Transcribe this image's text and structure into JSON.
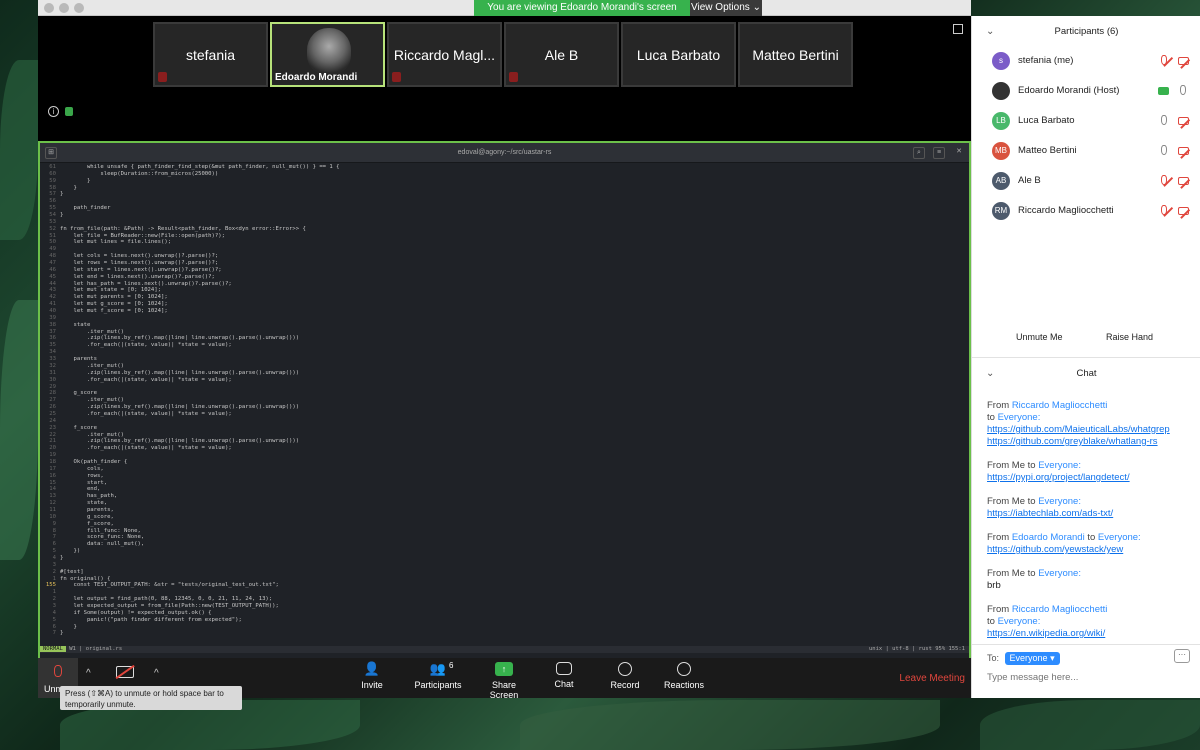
{
  "meeting": {
    "share_banner": "You are viewing Edoardo Morandi's screen",
    "view_options": "View Options"
  },
  "gallery": [
    {
      "name": "stefania",
      "muted": true
    },
    {
      "name": "Edoardo Morandi",
      "muted": false,
      "video": true
    },
    {
      "name": "Riccardo Magl...",
      "muted": true
    },
    {
      "name": "Ale B",
      "muted": true
    },
    {
      "name": "Luca Barbato",
      "muted": false
    },
    {
      "name": "Matteo Bertini",
      "muted": false
    }
  ],
  "terminal": {
    "title": "edoval@agony:~/src/uastar-rs",
    "status_mode": "NORMAL",
    "status_file": "W1 | original.rs",
    "status_right": "unix | utf-8 | rust   95%  155:1",
    "code_lines": [
      [
        "61",
        "        while unsafe { path_finder_find_step(&mut path_finder, null_mut()) } == 1 {"
      ],
      [
        "60",
        "            sleep(Duration::from_micros(25000))"
      ],
      [
        "59",
        "        }"
      ],
      [
        "58",
        "    }"
      ],
      [
        "57",
        "}"
      ],
      [
        "56",
        ""
      ],
      [
        "55",
        "    path_finder"
      ],
      [
        "54",
        "}"
      ],
      [
        "53",
        ""
      ],
      [
        "52",
        "fn from_file(path: &Path) -> Result<path_finder, Box<dyn error::Error>> {"
      ],
      [
        "51",
        "    let file = BufReader::new(File::open(path)?);"
      ],
      [
        "50",
        "    let mut lines = file.lines();"
      ],
      [
        "49",
        ""
      ],
      [
        "48",
        "    let cols = lines.next().unwrap()?.parse()?;"
      ],
      [
        "47",
        "    let rows = lines.next().unwrap()?.parse()?;"
      ],
      [
        "46",
        "    let start = lines.next().unwrap()?.parse()?;"
      ],
      [
        "45",
        "    let end = lines.next().unwrap()?.parse()?;"
      ],
      [
        "44",
        "    let has_path = lines.next().unwrap()?.parse()?;"
      ],
      [
        "43",
        "    let mut state = [0; 1024];"
      ],
      [
        "42",
        "    let mut parents = [0; 1024];"
      ],
      [
        "41",
        "    let mut g_score = [0; 1024];"
      ],
      [
        "40",
        "    let mut f_score = [0; 1024];"
      ],
      [
        "39",
        ""
      ],
      [
        "38",
        "    state"
      ],
      [
        "37",
        "        .iter_mut()"
      ],
      [
        "36",
        "        .zip(lines.by_ref().map(|line| line.unwrap().parse().unwrap()))"
      ],
      [
        "35",
        "        .for_each(|(state, value)| *state = value);"
      ],
      [
        "34",
        ""
      ],
      [
        "33",
        "    parents"
      ],
      [
        "32",
        "        .iter_mut()"
      ],
      [
        "31",
        "        .zip(lines.by_ref().map(|line| line.unwrap().parse().unwrap()))"
      ],
      [
        "30",
        "        .for_each(|(state, value)| *state = value);"
      ],
      [
        "29",
        ""
      ],
      [
        "28",
        "    g_score"
      ],
      [
        "27",
        "        .iter_mut()"
      ],
      [
        "26",
        "        .zip(lines.by_ref().map(|line| line.unwrap().parse().unwrap()))"
      ],
      [
        "25",
        "        .for_each(|(state, value)| *state = value);"
      ],
      [
        "24",
        ""
      ],
      [
        "23",
        "    f_score"
      ],
      [
        "22",
        "        .iter_mut()"
      ],
      [
        "21",
        "        .zip(lines.by_ref().map(|line| line.unwrap().parse().unwrap()))"
      ],
      [
        "20",
        "        .for_each(|(state, value)| *state = value);"
      ],
      [
        "19",
        ""
      ],
      [
        "18",
        "    Ok(path_finder {"
      ],
      [
        "17",
        "        cols,"
      ],
      [
        "16",
        "        rows,"
      ],
      [
        "15",
        "        start,"
      ],
      [
        "14",
        "        end,"
      ],
      [
        "13",
        "        has_path,"
      ],
      [
        "12",
        "        state,"
      ],
      [
        "11",
        "        parents,"
      ],
      [
        "10",
        "        g_score,"
      ],
      [
        "9",
        "        f_score,"
      ],
      [
        "8",
        "        fill_func: None,"
      ],
      [
        "7",
        "        score_func: None,"
      ],
      [
        "6",
        "        data: null_mut(),"
      ],
      [
        "5",
        "    })"
      ],
      [
        "4",
        "}"
      ],
      [
        "3",
        ""
      ],
      [
        "2",
        "#[test]"
      ],
      [
        "1",
        "fn original() {"
      ],
      [
        "155",
        "    const TEST_OUTPUT_PATH: &str = \"tests/original_test_out.txt\";"
      ],
      [
        "1",
        ""
      ],
      [
        "2",
        "    let output = find_path(0, 88, 12345, 0, 0, 21, 11, 24, 13);"
      ],
      [
        "3",
        "    let expected_output = from_file(Path::new(TEST_OUTPUT_PATH));"
      ],
      [
        "4",
        "    if Some(output) != expected_output.ok() {"
      ],
      [
        "5",
        "        panic!(\"path finder different from expected\");"
      ],
      [
        "6",
        "    }"
      ],
      [
        "7",
        "}"
      ]
    ]
  },
  "toolbar": {
    "unmute_label": "Unm",
    "invite": "Invite",
    "participants": "Participants",
    "participants_count": "6",
    "share_screen": "Share Screen",
    "chat": "Chat",
    "record": "Record",
    "reactions": "Reactions",
    "leave": "Leave Meeting",
    "tooltip_line1": "Press (⇧⌘A) to unmute or hold space bar to",
    "tooltip_line2": "temporarily unmute."
  },
  "participants_panel": {
    "title": "Participants (6)",
    "list": [
      {
        "initials": "s",
        "name": "stefania (me)",
        "color": "#7b5cc8",
        "mic_muted": true,
        "cam_muted": true,
        "sharing": false
      },
      {
        "initials": "",
        "name": "Edoardo Morandi (Host)",
        "color": "#333333",
        "mic_muted": false,
        "cam_muted": false,
        "sharing": true
      },
      {
        "initials": "LB",
        "name": "Luca Barbato",
        "color": "#49b86b",
        "mic_muted": false,
        "cam_muted": true,
        "sharing": false
      },
      {
        "initials": "MB",
        "name": "Matteo Bertini",
        "color": "#d9533f",
        "mic_muted": false,
        "cam_muted": true,
        "sharing": false
      },
      {
        "initials": "AB",
        "name": "Ale B",
        "color": "#4d5a6c",
        "mic_muted": true,
        "cam_muted": true,
        "sharing": false
      },
      {
        "initials": "RM",
        "name": "Riccardo Magliocchetti",
        "color": "#4d5a6c",
        "mic_muted": true,
        "cam_muted": true,
        "sharing": false
      }
    ],
    "unmute_me": "Unmute Me",
    "raise_hand": "Raise Hand"
  },
  "chat": {
    "title": "Chat",
    "messages": [
      {
        "from": "From ",
        "sender": "Riccardo Magliocchetti",
        "to": "to ",
        "recipient": "Everyone:",
        "lines": [
          "https://github.com/MaieuticalLabs/whatgrep",
          "https://github.com/greyblake/whatlang-rs"
        ]
      },
      {
        "from": "From Me to ",
        "recipient": "Everyone:",
        "lines": [
          "https://pypi.org/project/langdetect/"
        ]
      },
      {
        "from": "From Me to ",
        "recipient": "Everyone:",
        "lines": [
          "https://iabtechlab.com/ads-txt/"
        ]
      },
      {
        "from": "From ",
        "sender": "Edoardo Morandi",
        "to": " to ",
        "recipient": "Everyone:",
        "lines": [
          "https://github.com/yewstack/yew"
        ]
      },
      {
        "from": "From Me to ",
        "recipient": "Everyone:",
        "text": "brb"
      },
      {
        "from": "From ",
        "sender": "Riccardo Magliocchetti",
        "to": "to ",
        "recipient": "Everyone:",
        "lines": [
          "https://en.wikipedia.org/wiki/"
        ]
      }
    ],
    "to_label": "To:",
    "to_value": "Everyone",
    "more": "···",
    "placeholder": "Type message here..."
  }
}
